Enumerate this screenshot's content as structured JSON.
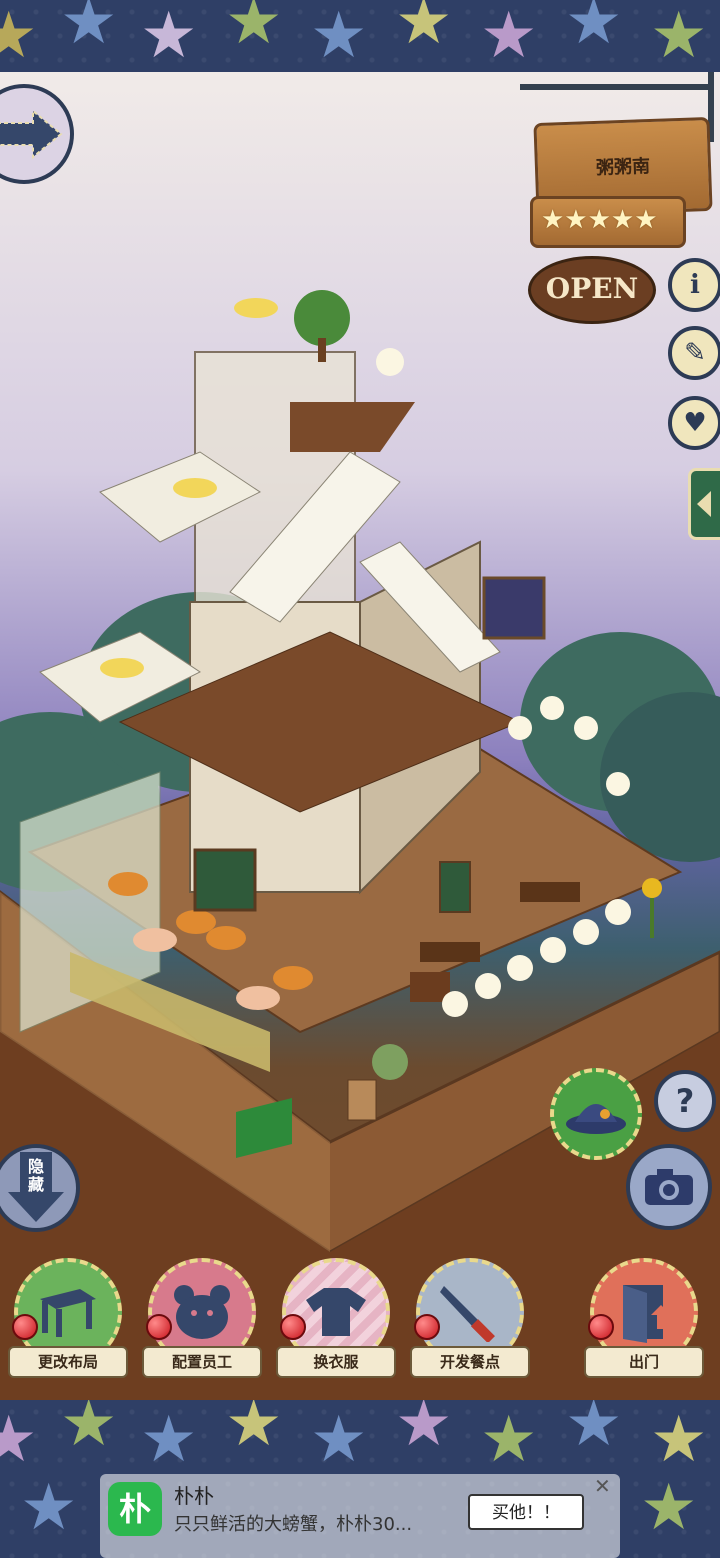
{
  "sign": {
    "shop_name": "粥粥南",
    "stars": "★★★★★",
    "open_label": "OPEN"
  },
  "side_buttons": {
    "info_glyph": "i",
    "book_glyph": "✎",
    "heart_glyph": "♥"
  },
  "hide_button": {
    "label": "隐藏"
  },
  "help_button": {
    "label": "?"
  },
  "tools": [
    {
      "label": "更改布局",
      "icon": "table-icon"
    },
    {
      "label": "配置员工",
      "icon": "bear-icon"
    },
    {
      "label": "换衣服",
      "icon": "shirt-icon"
    },
    {
      "label": "开发餐点",
      "icon": "knife-icon"
    },
    {
      "label": "出门",
      "icon": "door-icon"
    }
  ],
  "ad": {
    "icon_text": "朴",
    "title": "朴朴",
    "description": "只只鲜活的大螃蟹，朴朴30...",
    "cta": "买他！！",
    "close": "✕"
  }
}
